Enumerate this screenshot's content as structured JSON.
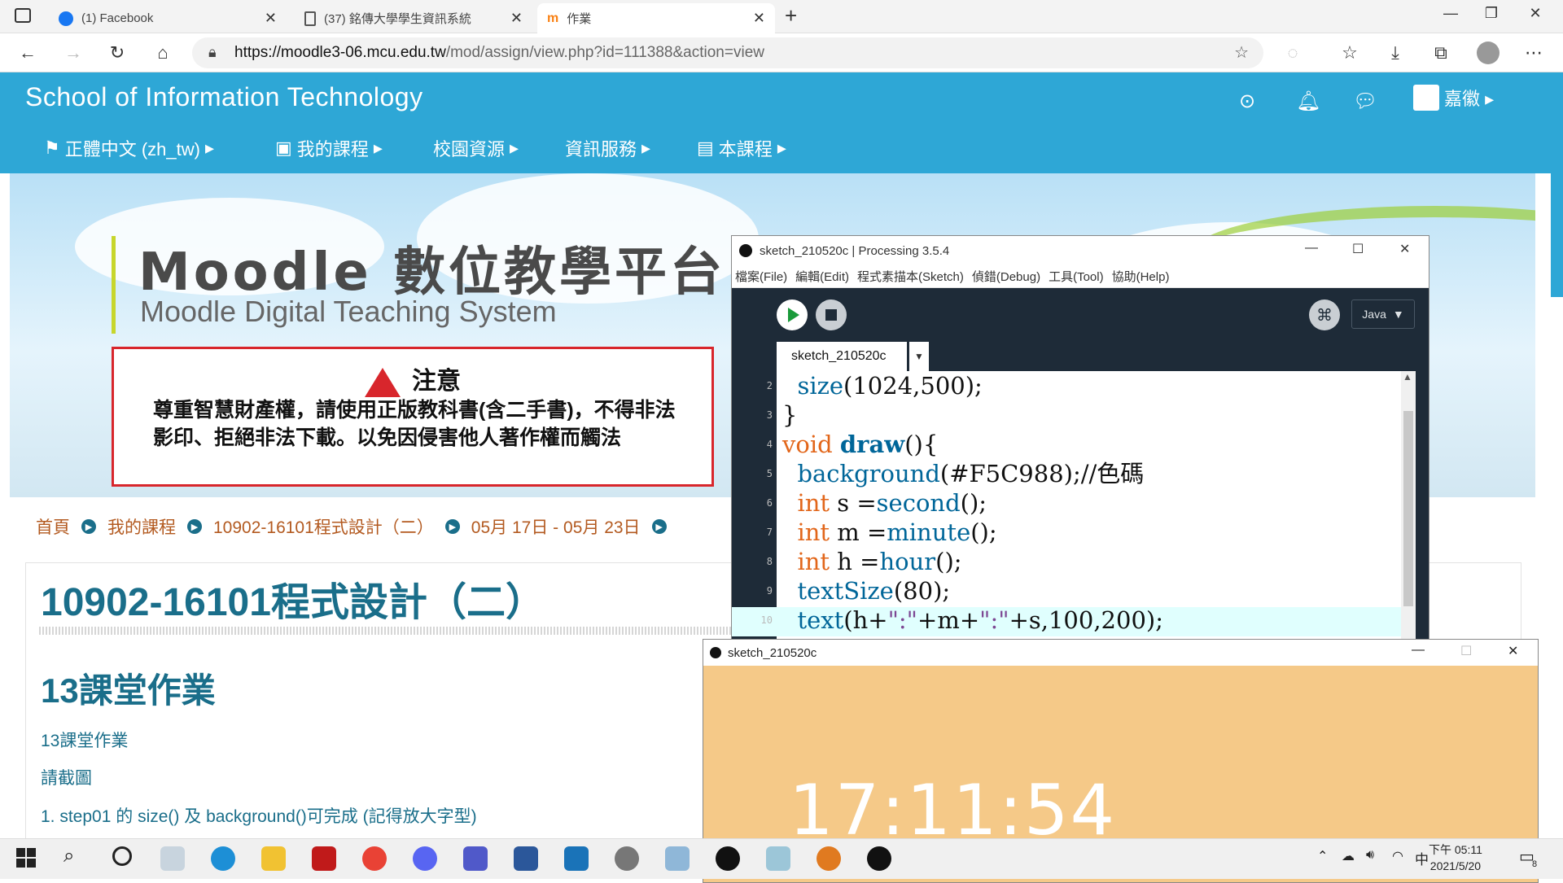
{
  "browser": {
    "tabs": [
      {
        "title": "(1) Facebook",
        "icon": "facebook-icon",
        "active": false
      },
      {
        "title": "(37) 銘傳大學學生資訊系統",
        "icon": "document-icon",
        "active": false
      },
      {
        "title": "作業",
        "icon": "moodle-icon",
        "active": true
      }
    ],
    "new_tab": "+",
    "url_host": "https://moodle3-06.mcu.edu.tw",
    "url_path": "/mod/assign/view.php?id=111388&action=view"
  },
  "site": {
    "title": "School of Information Technology",
    "user": "嘉徽",
    "menu": [
      "正體中文 (zh_tw)",
      "我的課程",
      "校園資源",
      "資訊服務",
      "本課程"
    ]
  },
  "banner": {
    "title": "Moodle 數位教學平台",
    "subtitle": "Moodle Digital Teaching System",
    "notice_title": "注意",
    "notice_body": "尊重智慧財產權，請使用正版教科書(含二手書)，不得非法影印、拒絕非法下載。以免因侵害他人著作權而觸法"
  },
  "breadcrumb": [
    "首頁",
    "我的課程",
    "10902-16101程式設計（二）",
    "05月 17日 - 05月 23日"
  ],
  "course": {
    "title": "10902-16101程式設計（二）",
    "assignment_title": "13課堂作業",
    "lines": [
      "13課堂作業",
      "請截圖",
      "1. step01 的 size() 及 background()可完成 (記得放大字型)"
    ]
  },
  "ide": {
    "title": "sketch_210520c | Processing 3.5.4",
    "menus": [
      "檔案(File)",
      "編輯(Edit)",
      "程式素描本(Sketch)",
      "偵錯(Debug)",
      "工具(Tool)",
      "協助(Help)"
    ],
    "mode": "Java",
    "tab": "sketch_210520c",
    "code": [
      {
        "n": "2",
        "text": "  size(1024,500);"
      },
      {
        "n": "3",
        "text": "}"
      },
      {
        "n": "4",
        "text": "void draw(){"
      },
      {
        "n": "5",
        "text": "  background(#F5C988);//色碼"
      },
      {
        "n": "6",
        "text": "  int s =second();"
      },
      {
        "n": "7",
        "text": "  int m =minute();"
      },
      {
        "n": "8",
        "text": "  int h =hour();"
      },
      {
        "n": "9",
        "text": "  textSize(80);"
      },
      {
        "n": "10",
        "text": "  text(h+\":\"+m+\":\"+s,100,200);"
      }
    ]
  },
  "sketch": {
    "title": "sketch_210520c",
    "background": "#F5C988",
    "clock_text": "17:11:54"
  },
  "taskbar": {
    "time": "下午 05:11",
    "date": "2021/5/20",
    "ime": "中",
    "notifications": "8"
  },
  "colors": {
    "moodle_blue": "#2ea7d6",
    "link_teal": "#1a6e8a",
    "crumb_brown": "#b35a20"
  }
}
